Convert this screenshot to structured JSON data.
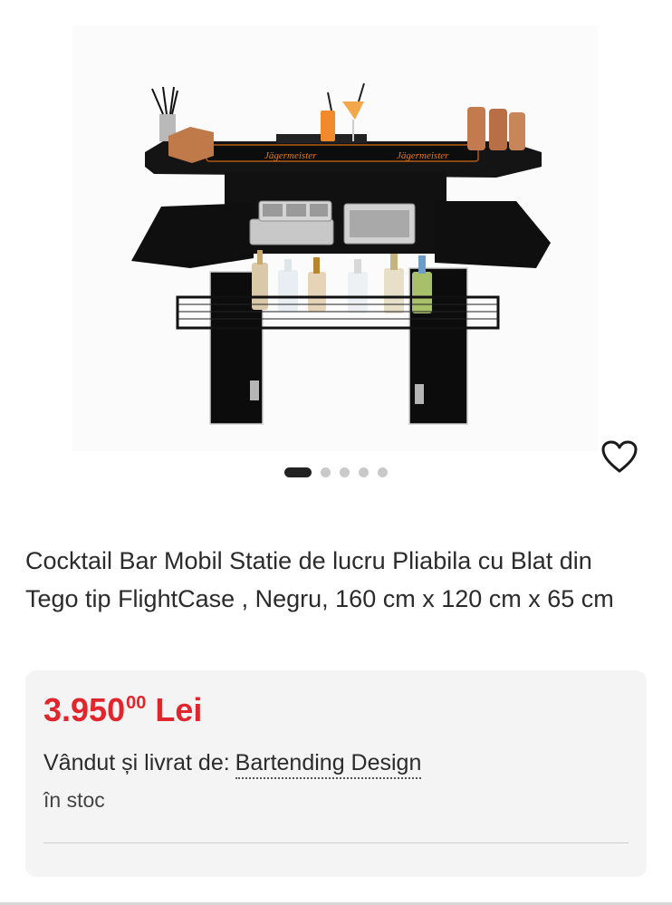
{
  "product": {
    "title": "Cocktail Bar Mobil Statie de lucru Pliabila cu Blat din Tego tip FlightCase , Negru, 160 cm x 120 cm x 65 cm",
    "image_count": 5,
    "active_image": 1,
    "mat_text_left": "Jägermeister",
    "mat_text_right": "Jägermeister"
  },
  "offer": {
    "price_main": "3.950",
    "price_cents": "00",
    "currency": "Lei",
    "seller_label": "Vândut și livrat de:",
    "seller_name": "Bartending Design",
    "stock": "în stoc"
  },
  "icons": {
    "wishlist": "heart-outline-icon"
  },
  "colors": {
    "price": "#e0262c",
    "card_bg": "#f4f4f4",
    "dot_active": "#222222",
    "dot_inactive": "#c9c9c9"
  }
}
